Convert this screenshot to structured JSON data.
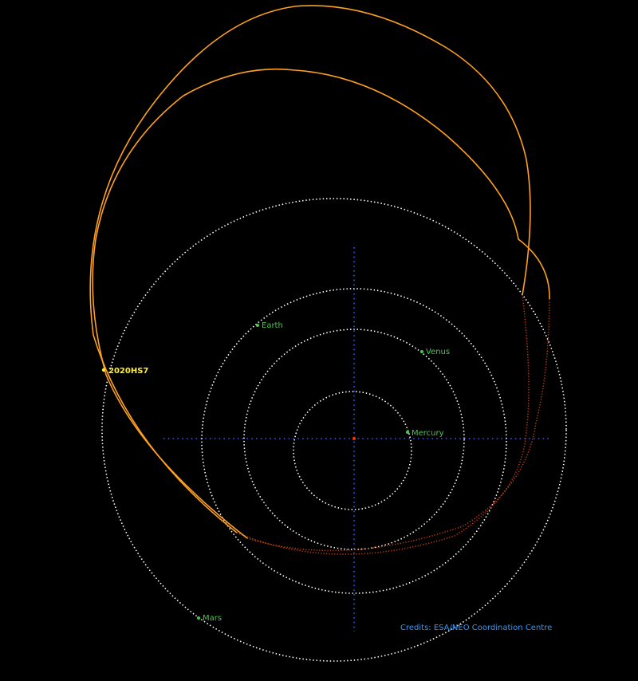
{
  "diagram": {
    "planets": [
      {
        "name": "Mercury",
        "label": "Mercury"
      },
      {
        "name": "Venus",
        "label": "Venus"
      },
      {
        "name": "Earth",
        "label": "Earth"
      },
      {
        "name": "Mars",
        "label": "Mars"
      }
    ],
    "object": {
      "label": "2020HS7"
    },
    "credits": "Credits: ESA/NEO Coordination Centre",
    "colors": {
      "background": "#000000",
      "planet_orbit": "#ffffff",
      "planet_marker": "#44cc44",
      "planet_label": "#44cc44",
      "object_orbit_above": "#ffa020",
      "object_orbit_below": "#c84010",
      "object_label": "#ffee33",
      "axes": "#3355ff",
      "sun": "#ff3300",
      "credits": "#3399ff"
    }
  }
}
